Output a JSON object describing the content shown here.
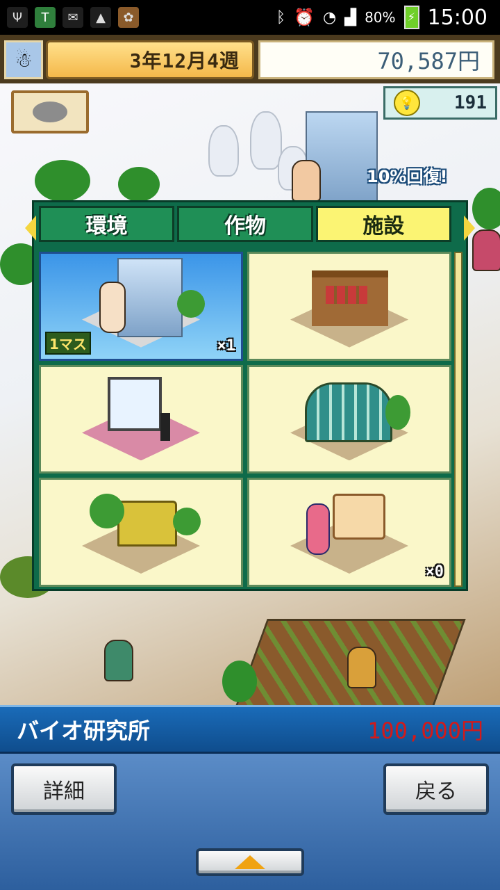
{
  "status_bar": {
    "time": "15:00",
    "battery": "80%",
    "left_icons": [
      "usb-icon",
      "shield-app-icon",
      "gmail-icon",
      "gallery-icon",
      "photo-thumb-icon"
    ],
    "right_icons": [
      "bluetooth-icon",
      "alarm-icon",
      "wifi-icon",
      "signal-icon",
      "battery-charging-icon"
    ]
  },
  "header": {
    "date": "3年12月4週",
    "money": "70,587円",
    "ideas": "191"
  },
  "scene": {
    "recovery_text": "10%回復!"
  },
  "tabs": [
    {
      "label": "環境",
      "active": false
    },
    {
      "label": "作物",
      "active": false
    },
    {
      "label": "施設",
      "active": true
    }
  ],
  "facilities": [
    {
      "icon": "bio-lab-building-icon",
      "size_tag": "1マス",
      "count": "×1",
      "selected": true
    },
    {
      "icon": "vegetable-stall-icon",
      "size_tag": "",
      "count": "",
      "selected": false
    },
    {
      "icon": "billboard-cow-icon",
      "size_tag": "",
      "count": "",
      "selected": false
    },
    {
      "icon": "greenhouse-icon",
      "size_tag": "",
      "count": "",
      "selected": false
    },
    {
      "icon": "thatched-hut-icon",
      "size_tag": "",
      "count": "",
      "selected": false
    },
    {
      "icon": "drink-stand-icon",
      "size_tag": "",
      "count": "×0",
      "selected": false
    }
  ],
  "selected_item": {
    "name": "バイオ研究所",
    "price": "100,000円"
  },
  "buttons": {
    "detail": "詳細",
    "back": "戻る"
  },
  "colors": {
    "panel_green": "#0e6b4a",
    "active_tab": "#fbf473",
    "info_bar_blue": "#1a6bb8",
    "price_red": "#d21a1a"
  }
}
